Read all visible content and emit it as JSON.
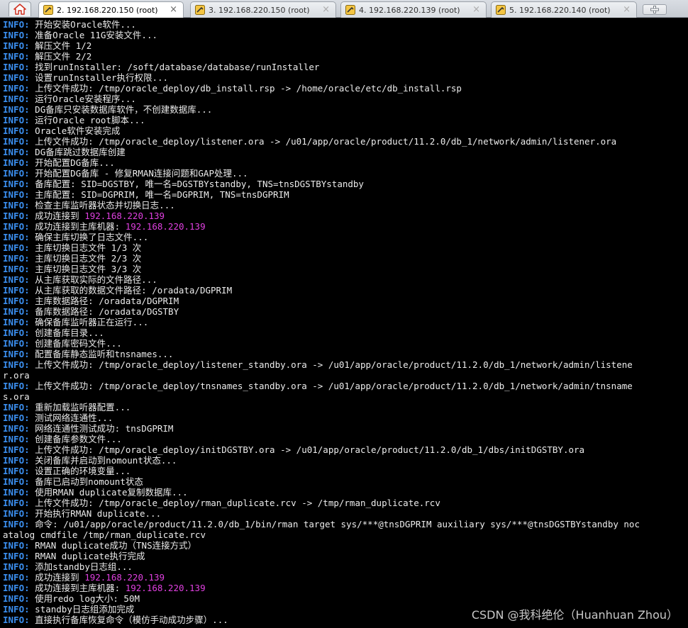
{
  "tabs": [
    {
      "label": "2. 192.168.220.150 (root)",
      "active": true,
      "close": "×"
    },
    {
      "label": "3. 192.168.220.150 (root)",
      "active": false,
      "close": "×"
    },
    {
      "label": "4. 192.168.220.139 (root)",
      "active": false,
      "close": "×"
    },
    {
      "label": "5. 192.168.220.140 (root)",
      "active": false,
      "close": "×"
    }
  ],
  "prefix": "INFO:",
  "lines": [
    {
      "text": " 开始安装Oracle软件..."
    },
    {
      "text": " 准备Oracle 11G安装文件..."
    },
    {
      "text": " 解压文件 1/2"
    },
    {
      "text": " 解压文件 2/2"
    },
    {
      "text": " 找到runInstaller: /soft/database/database/runInstaller"
    },
    {
      "text": " 设置runInstaller执行权限..."
    },
    {
      "text": " 上传文件成功: /tmp/oracle_deploy/db_install.rsp -> /home/oracle/etc/db_install.rsp"
    },
    {
      "text": " 运行Oracle安装程序..."
    },
    {
      "text": " DG备库只安装数据库软件，不创建数据库..."
    },
    {
      "text": " 运行Oracle root脚本..."
    },
    {
      "text": " Oracle软件安装完成"
    },
    {
      "text": " 上传文件成功: /tmp/oracle_deploy/listener.ora -> /u01/app/oracle/product/11.2.0/db_1/network/admin/listener.ora"
    },
    {
      "text": " DG备库跳过数据库创建"
    },
    {
      "text": " 开始配置DG备库..."
    },
    {
      "text": " 开始配置DG备库 - 修复RMAN连接问题和GAP处理..."
    },
    {
      "text": " 备库配置: SID=DGSTBY, 唯一名=DGSTBYstandby, TNS=tnsDGSTBYstandby"
    },
    {
      "text": " 主库配置: SID=DGPRIM, 唯一名=DGPRIM, TNS=tnsDGPRIM"
    },
    {
      "text": " 检查主库监听器状态并切换日志..."
    },
    {
      "text": " 成功连接到 ",
      "ip": "192.168.220.139"
    },
    {
      "text": " 成功连接到主库机器: ",
      "ip": "192.168.220.139"
    },
    {
      "text": " 确保主库切换了日志文件..."
    },
    {
      "text": " 主库切换日志文件 1/3 次"
    },
    {
      "text": " 主库切换日志文件 2/3 次"
    },
    {
      "text": " 主库切换日志文件 3/3 次"
    },
    {
      "text": " 从主库获取实际的文件路径..."
    },
    {
      "text": " 从主库获取的数据文件路径: /oradata/DGPRIM"
    },
    {
      "text": " 主库数据路径: /oradata/DGPRIM"
    },
    {
      "text": " 备库数据路径: /oradata/DGSTBY"
    },
    {
      "text": " 确保备库监听器正在运行..."
    },
    {
      "text": " 创建备库目录..."
    },
    {
      "text": " 创建备库密码文件..."
    },
    {
      "text": " 配置备库静态监听和tnsnames..."
    },
    {
      "text": " 上传文件成功: /tmp/oracle_deploy/listener_standby.ora -> /u01/app/oracle/product/11.2.0/db_1/network/admin/listene"
    },
    {
      "cont": "r.ora"
    },
    {
      "text": " 上传文件成功: /tmp/oracle_deploy/tnsnames_standby.ora -> /u01/app/oracle/product/11.2.0/db_1/network/admin/tnsname"
    },
    {
      "cont": "s.ora"
    },
    {
      "text": " 重新加载监听器配置..."
    },
    {
      "text": " 测试网络连通性..."
    },
    {
      "text": " 网络连通性测试成功: tnsDGPRIM"
    },
    {
      "text": " 创建备库参数文件..."
    },
    {
      "text": " 上传文件成功: /tmp/oracle_deploy/initDGSTBY.ora -> /u01/app/oracle/product/11.2.0/db_1/dbs/initDGSTBY.ora"
    },
    {
      "text": " 关闭备库并启动到nomount状态..."
    },
    {
      "text": " 设置正确的环境变量..."
    },
    {
      "text": " 备库已启动到nomount状态"
    },
    {
      "text": " 使用RMAN duplicate复制数据库..."
    },
    {
      "text": " 上传文件成功: /tmp/oracle_deploy/rman_duplicate.rcv -> /tmp/rman_duplicate.rcv"
    },
    {
      "text": " 开始执行RMAN duplicate..."
    },
    {
      "text": " 命令: /u01/app/oracle/product/11.2.0/db_1/bin/rman target sys/***@tnsDGPRIM auxiliary sys/***@tnsDGSTBYstandby noc"
    },
    {
      "cont": "atalog cmdfile /tmp/rman_duplicate.rcv"
    },
    {
      "text": " RMAN duplicate成功（TNS连接方式）"
    },
    {
      "text": " RMAN duplicate执行完成"
    },
    {
      "text": " 添加standby日志组..."
    },
    {
      "text": " 成功连接到 ",
      "ip": "192.168.220.139"
    },
    {
      "text": " 成功连接到主库机器: ",
      "ip": "192.168.220.139"
    },
    {
      "text": " 使用redo log大小: 50M"
    },
    {
      "text": " standby日志组添加完成"
    },
    {
      "text": " 直接执行备库恢复命令（模仿手动成功步骤）..."
    }
  ],
  "watermark": "CSDN @我科绝伦（Huanhuan Zhou）"
}
